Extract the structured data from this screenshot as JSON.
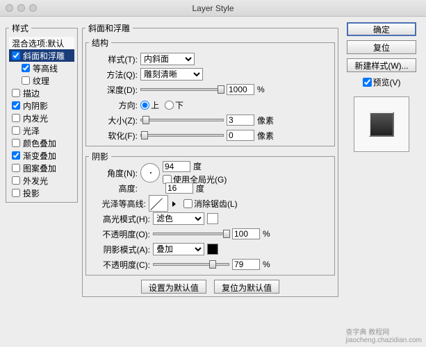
{
  "window": {
    "title": "Layer Style"
  },
  "sidebar": {
    "legend": "样式",
    "blend_label": "混合选项:默认",
    "items": [
      {
        "label": "斜面和浮雕",
        "checked": true,
        "selected": true
      },
      {
        "label": "等高线",
        "checked": true,
        "indent": true
      },
      {
        "label": "纹理",
        "checked": false,
        "indent": true
      },
      {
        "label": "描边",
        "checked": false
      },
      {
        "label": "内阴影",
        "checked": true
      },
      {
        "label": "内发光",
        "checked": false
      },
      {
        "label": "光泽",
        "checked": false
      },
      {
        "label": "颜色叠加",
        "checked": false
      },
      {
        "label": "渐变叠加",
        "checked": true
      },
      {
        "label": "图案叠加",
        "checked": false
      },
      {
        "label": "外发光",
        "checked": false
      },
      {
        "label": "投影",
        "checked": false
      }
    ]
  },
  "main": {
    "legend": "斜面和浮雕",
    "struct": {
      "legend": "结构",
      "style_label": "样式(T):",
      "style_value": "内斜面",
      "technique_label": "方法(Q):",
      "technique_value": "雕刻清晰",
      "depth_label": "深度(D):",
      "depth_value": "1000",
      "depth_unit": "%",
      "direction_label": "方向:",
      "up": "上",
      "down": "下",
      "size_label": "大小(Z):",
      "size_value": "3",
      "size_unit": "像素",
      "soften_label": "软化(F):",
      "soften_value": "0",
      "soften_unit": "像素"
    },
    "shade": {
      "legend": "阴影",
      "angle_label": "角度(N):",
      "angle_value": "94",
      "angle_unit": "度",
      "global_label": "使用全局光(G)",
      "altitude_label": "高度:",
      "altitude_value": "16",
      "altitude_unit": "度",
      "gloss_label": "光泽等高线:",
      "anti_label": "消除锯齿(L)",
      "hi_mode_label": "高光模式(H):",
      "hi_mode_value": "滤色",
      "hi_opacity_label": "不透明度(O):",
      "hi_opacity_value": "100",
      "opacity_unit": "%",
      "sh_mode_label": "阴影模式(A):",
      "sh_mode_value": "叠加",
      "sh_opacity_label": "不透明度(C):",
      "sh_opacity_value": "79"
    },
    "defaults_btn": "设置为默认值",
    "reset_btn": "复位为默认值"
  },
  "right": {
    "ok": "确定",
    "cancel": "复位",
    "newstyle": "新建样式(W)...",
    "preview_label": "预览(V)"
  },
  "water": "查字典  教程网",
  "water2": "jiaocheng.chazidian.com"
}
